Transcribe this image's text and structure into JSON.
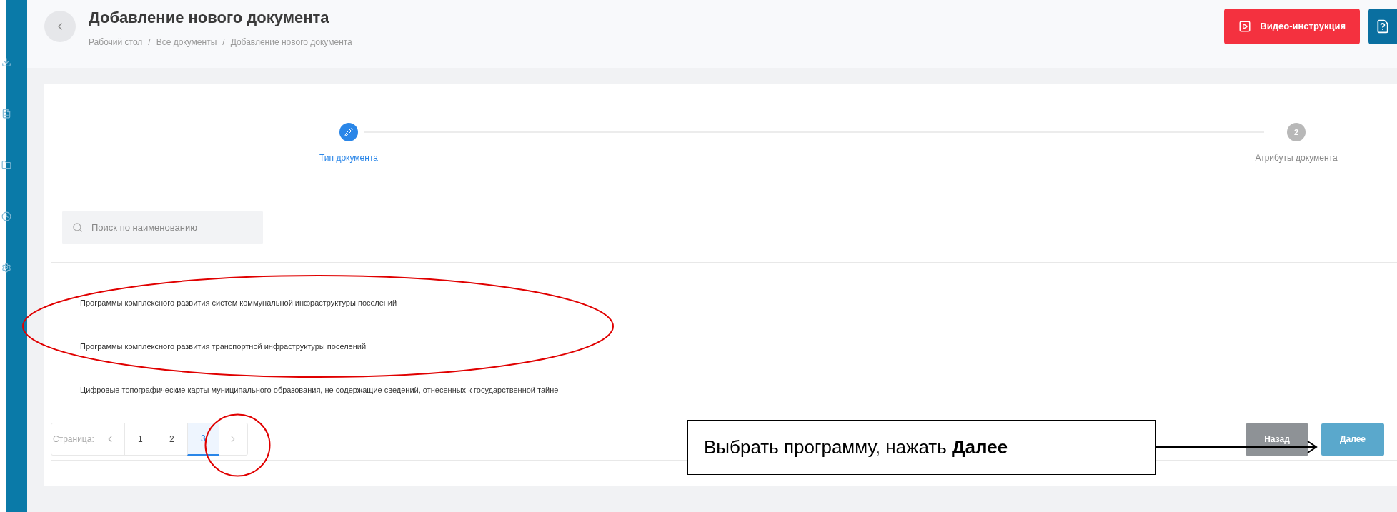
{
  "header": {
    "title": "Добавление нового документа",
    "breadcrumbs": [
      "Рабочий стол",
      "Все документы",
      "Добавление нового документа"
    ],
    "separator": "/",
    "video_button": "Видео-инструкция"
  },
  "stepper": {
    "steps": [
      {
        "kind": "edit",
        "label": "Тип документа",
        "active": true
      },
      {
        "kind": "number",
        "number": "2",
        "label": "Атрибуты документа",
        "active": false
      }
    ]
  },
  "search": {
    "placeholder": "Поиск по наименованию"
  },
  "rows": [
    {
      "text": "Программы комплексного развития систем коммунальной инфраструктуры поселений"
    },
    {
      "text": "Программы комплексного развития транспортной инфраструктуры поселений"
    },
    {
      "text": "Цифровые топографические карты муниципального образования, не содержащие сведений, отнесенных к государственной тайне"
    }
  ],
  "pagination": {
    "label": "Страница:",
    "pages": [
      {
        "label": "1",
        "selected": false
      },
      {
        "label": "2",
        "selected": false
      },
      {
        "label": "3",
        "selected": true
      }
    ]
  },
  "footer_buttons": [
    {
      "label": "Назад",
      "kind": "secondary"
    },
    {
      "label": "Далее",
      "kind": "primary"
    }
  ],
  "annotation": {
    "callout": "Выбрать программу, нажать  **Далее**"
  }
}
